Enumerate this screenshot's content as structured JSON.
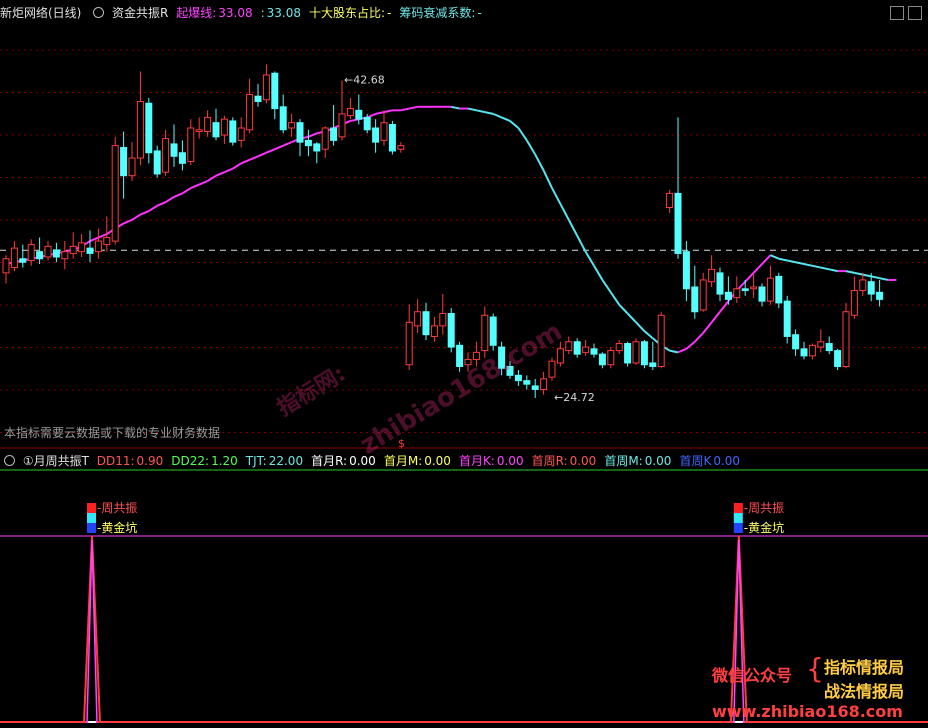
{
  "header": {
    "stock_name": "新炬网络(日线)",
    "indicator_name": "资金共振R",
    "items": [
      {
        "label": "起爆线:",
        "value": "33.08",
        "color": "#ff44ff"
      },
      {
        "label": ":",
        "value": "33.08",
        "color": "#6fe6e6"
      },
      {
        "label": "十大股东占比:",
        "value": "-",
        "color": "#ffff66"
      },
      {
        "label": "筹码衰减系数:",
        "value": "-",
        "color": "#6fe6e6"
      }
    ]
  },
  "indicator_header": {
    "title": "①月周共振T",
    "items": [
      {
        "label": "DD11:",
        "value": "0.90",
        "color": "#ff5555"
      },
      {
        "label": "DD22:",
        "value": "1.20",
        "color": "#55ff55"
      },
      {
        "label": "TJT:",
        "value": "22.00",
        "color": "#6fe6e6"
      },
      {
        "label": "首月R:",
        "value": "0.00",
        "color": "#ffffff"
      },
      {
        "label": "首月M:",
        "value": "0.00",
        "color": "#ffff66"
      },
      {
        "label": "首月K:",
        "value": "0.00",
        "color": "#ff44ff"
      },
      {
        "label": "首周R:",
        "value": "0.00",
        "color": "#ff5555"
      },
      {
        "label": "首周M:",
        "value": "0.00",
        "color": "#6fe6e6"
      },
      {
        "label": "首周K",
        "value": "0.00",
        "color": "#4466ff"
      }
    ]
  },
  "note": "本指标需要云数据或下载的专业财务数据",
  "watermark": {
    "diag": "zhibiao168.com",
    "diag_prefix": "指标网:",
    "wechat_label": "微信公众号",
    "brand1": "指标情报局",
    "brand2": "战法情报局",
    "site": "www.zhibiao168.com"
  },
  "colors": {
    "up": "#ff3b3b",
    "down": "#54ffff",
    "ma_up": "#ff33ff",
    "ma_down": "#55e6f0"
  },
  "chart_data": [
    {
      "type": "candlestick",
      "title": "新炬网络(日线)",
      "ylim": [
        22,
        46
      ],
      "annotations": [
        {
          "text": "42.68",
          "x": 40,
          "y": 42.68
        },
        {
          "text": "24.72",
          "x": 65,
          "y": 24.72
        }
      ],
      "reference_line": 33.08,
      "candles": [
        [
          31.8,
          32.6,
          31.2,
          32.8
        ],
        [
          32.1,
          33.2,
          31.9,
          33.6
        ],
        [
          32.6,
          32.4,
          32.1,
          33.4
        ],
        [
          32.5,
          33.4,
          32.2,
          33.7
        ],
        [
          33.0,
          32.6,
          32.3,
          33.8
        ],
        [
          32.7,
          33.3,
          32.5,
          33.6
        ],
        [
          33.1,
          32.7,
          32.4,
          33.5
        ],
        [
          32.6,
          33.0,
          32.0,
          33.6
        ],
        [
          32.9,
          33.3,
          32.6,
          34.1
        ],
        [
          33.0,
          33.5,
          32.7,
          34.0
        ],
        [
          33.2,
          32.9,
          32.4,
          34.2
        ],
        [
          33.0,
          33.6,
          32.6,
          34.3
        ],
        [
          33.4,
          33.8,
          33.0,
          35.0
        ],
        [
          33.6,
          39.0,
          33.4,
          39.5
        ],
        [
          38.9,
          37.3,
          36.0,
          39.8
        ],
        [
          37.3,
          38.3,
          37.0,
          39.2
        ],
        [
          38.3,
          41.5,
          37.9,
          43.2
        ],
        [
          41.4,
          38.6,
          38.0,
          41.7
        ],
        [
          38.7,
          37.4,
          37.2,
          39.0
        ],
        [
          37.5,
          39.4,
          37.3,
          39.9
        ],
        [
          39.1,
          38.4,
          37.8,
          40.2
        ],
        [
          38.6,
          38.0,
          37.6,
          39.3
        ],
        [
          38.1,
          40.0,
          37.9,
          40.5
        ],
        [
          39.8,
          39.9,
          39.4,
          40.6
        ],
        [
          39.8,
          40.6,
          39.5,
          41.0
        ],
        [
          40.3,
          39.5,
          39.3,
          41.1
        ],
        [
          39.6,
          40.5,
          39.1,
          40.7
        ],
        [
          40.4,
          39.2,
          39.0,
          40.6
        ],
        [
          39.3,
          40.0,
          38.9,
          40.6
        ],
        [
          39.9,
          41.9,
          39.7,
          42.8
        ],
        [
          41.8,
          41.5,
          41.2,
          42.5
        ],
        [
          41.6,
          43.0,
          41.4,
          43.6
        ],
        [
          43.1,
          41.1,
          40.5,
          43.2
        ],
        [
          41.2,
          39.9,
          39.7,
          41.9
        ],
        [
          40.0,
          40.3,
          39.5,
          40.8
        ],
        [
          40.3,
          39.2,
          38.4,
          40.5
        ],
        [
          39.3,
          39.0,
          38.4,
          39.9
        ],
        [
          39.1,
          38.7,
          38.0,
          39.2
        ],
        [
          38.8,
          40.0,
          38.3,
          40.1
        ],
        [
          40.0,
          39.3,
          39.0,
          41.3
        ],
        [
          39.5,
          40.8,
          39.3,
          42.68
        ],
        [
          40.7,
          41.1,
          40.5,
          41.7
        ],
        [
          41.0,
          40.5,
          40.2,
          41.9
        ],
        [
          40.6,
          39.9,
          39.7,
          40.8
        ],
        [
          40.0,
          39.2,
          38.6,
          40.5
        ],
        [
          39.3,
          40.3,
          39.0,
          41.0
        ],
        [
          40.2,
          38.7,
          38.5,
          40.4
        ],
        [
          38.8,
          39.0,
          38.6,
          39.2
        ],
        [
          26.6,
          29.0,
          26.3,
          30.0
        ],
        [
          28.8,
          29.6,
          28.4,
          30.3
        ],
        [
          29.6,
          28.3,
          28.0,
          30.1
        ],
        [
          28.2,
          28.8,
          27.9,
          29.3
        ],
        [
          28.8,
          29.5,
          28.3,
          30.6
        ],
        [
          29.5,
          27.6,
          27.3,
          29.8
        ],
        [
          27.7,
          26.5,
          26.2,
          27.9
        ],
        [
          26.6,
          26.9,
          26.2,
          27.3
        ],
        [
          26.9,
          27.3,
          26.5,
          27.9
        ],
        [
          27.4,
          29.4,
          27.0,
          29.9
        ],
        [
          29.3,
          27.7,
          27.4,
          29.5
        ],
        [
          27.6,
          26.4,
          26.0,
          27.9
        ],
        [
          26.5,
          26.0,
          25.8,
          26.8
        ],
        [
          26.0,
          25.7,
          25.4,
          26.3
        ],
        [
          25.7,
          25.5,
          25.2,
          26.0
        ],
        [
          25.4,
          25.2,
          24.72,
          25.8
        ],
        [
          25.2,
          25.8,
          24.9,
          26.2
        ],
        [
          25.9,
          26.8,
          25.7,
          27.0
        ],
        [
          26.7,
          27.5,
          26.5,
          27.9
        ],
        [
          27.4,
          27.9,
          27.2,
          28.2
        ],
        [
          27.9,
          27.2,
          27.0,
          28.1
        ],
        [
          27.3,
          27.6,
          27.1,
          28.0
        ],
        [
          27.5,
          27.2,
          27.0,
          27.8
        ],
        [
          27.2,
          26.6,
          26.4,
          27.3
        ],
        [
          26.6,
          27.4,
          26.4,
          27.6
        ],
        [
          27.4,
          27.8,
          27.2,
          28.0
        ],
        [
          27.8,
          26.7,
          26.5,
          27.9
        ],
        [
          26.7,
          27.9,
          26.6,
          28.1
        ],
        [
          27.9,
          26.6,
          26.4,
          28.0
        ],
        [
          26.7,
          26.5,
          26.3,
          27.9
        ],
        [
          26.5,
          29.4,
          26.4,
          29.6
        ],
        [
          35.5,
          36.3,
          35.2,
          36.5
        ],
        [
          36.3,
          32.9,
          32.6,
          40.6
        ],
        [
          33.0,
          30.9,
          30.2,
          33.6
        ],
        [
          31.0,
          29.6,
          29.2,
          32.2
        ],
        [
          29.7,
          31.4,
          29.6,
          31.8
        ],
        [
          31.3,
          32.0,
          31.0,
          32.8
        ],
        [
          31.8,
          30.6,
          30.2,
          32.1
        ],
        [
          30.7,
          30.3,
          30.0,
          31.6
        ],
        [
          30.4,
          30.9,
          30.1,
          31.6
        ],
        [
          30.9,
          30.8,
          30.5,
          31.4
        ],
        [
          30.9,
          31.0,
          30.4,
          31.7
        ],
        [
          31.0,
          30.2,
          29.9,
          31.2
        ],
        [
          30.2,
          31.5,
          30.0,
          32.2
        ],
        [
          31.6,
          30.1,
          29.8,
          31.8
        ],
        [
          30.2,
          28.2,
          27.8,
          30.5
        ],
        [
          28.3,
          27.5,
          27.1,
          28.6
        ],
        [
          27.5,
          27.1,
          26.9,
          27.9
        ],
        [
          27.1,
          27.7,
          26.9,
          27.8
        ],
        [
          27.6,
          27.9,
          27.3,
          28.6
        ],
        [
          27.8,
          27.4,
          27.2,
          28.2
        ],
        [
          27.4,
          26.5,
          26.3,
          27.5
        ],
        [
          26.5,
          29.6,
          26.4,
          30.1
        ],
        [
          29.4,
          30.8,
          29.2,
          31.6
        ],
        [
          30.8,
          31.4,
          30.5,
          31.8
        ],
        [
          31.3,
          30.6,
          30.2,
          31.8
        ],
        [
          30.7,
          30.3,
          29.9,
          31.4
        ]
      ],
      "ma_line": [
        32.3,
        32.4,
        32.5,
        32.6,
        32.7,
        32.8,
        32.9,
        33.0,
        33.1,
        33.3,
        33.6,
        33.8,
        34.0,
        34.3,
        34.6,
        34.8,
        35.1,
        35.3,
        35.6,
        35.8,
        36.1,
        36.3,
        36.6,
        36.8,
        37.0,
        37.3,
        37.5,
        37.7,
        38.0,
        38.2,
        38.4,
        38.6,
        38.8,
        39.0,
        39.2,
        39.4,
        39.5,
        39.7,
        39.8,
        40.0,
        40.2,
        40.4,
        40.5,
        40.6,
        40.8,
        40.9,
        41.0,
        41.0,
        41.1,
        41.2,
        41.2,
        41.2,
        41.2,
        41.2,
        41.1,
        41.1,
        41.0,
        40.9,
        40.8,
        40.6,
        40.4,
        40.0,
        39.3,
        38.5,
        37.6,
        36.6,
        35.7,
        34.8,
        33.9,
        33.0,
        32.2,
        31.4,
        30.7,
        30.0,
        29.5,
        29.0,
        28.5,
        28.1,
        27.7,
        27.4,
        27.3,
        27.5,
        27.9,
        28.4,
        29.0,
        29.6,
        30.2,
        30.8,
        31.3,
        31.8,
        32.3,
        32.8,
        32.6,
        32.5,
        32.4,
        32.3,
        32.2,
        32.1,
        32.0,
        31.9,
        31.9,
        31.8,
        31.7,
        31.6,
        31.5,
        31.4,
        31.4
      ]
    },
    {
      "type": "bar",
      "title": "①月周共振T",
      "ylim": [
        0,
        1
      ],
      "signals": [
        {
          "x": 10,
          "value": 1,
          "labels": [
            "周共振",
            "黄金坑"
          ]
        },
        {
          "x": 87,
          "value": 1,
          "labels": [
            "周共振",
            "黄金坑"
          ]
        }
      ]
    }
  ]
}
